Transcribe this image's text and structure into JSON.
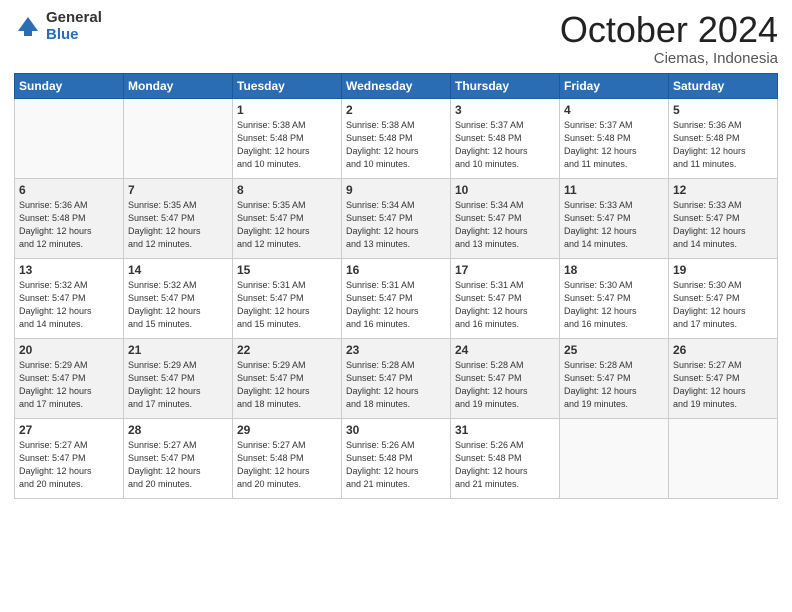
{
  "logo": {
    "general": "General",
    "blue": "Blue"
  },
  "header": {
    "title": "October 2024",
    "subtitle": "Ciemas, Indonesia"
  },
  "weekdays": [
    "Sunday",
    "Monday",
    "Tuesday",
    "Wednesday",
    "Thursday",
    "Friday",
    "Saturday"
  ],
  "weeks": [
    [
      {
        "day": "",
        "sunrise": "",
        "sunset": "",
        "daylight": ""
      },
      {
        "day": "",
        "sunrise": "",
        "sunset": "",
        "daylight": ""
      },
      {
        "day": "1",
        "sunrise": "Sunrise: 5:38 AM",
        "sunset": "Sunset: 5:48 PM",
        "daylight": "Daylight: 12 hours and 10 minutes."
      },
      {
        "day": "2",
        "sunrise": "Sunrise: 5:38 AM",
        "sunset": "Sunset: 5:48 PM",
        "daylight": "Daylight: 12 hours and 10 minutes."
      },
      {
        "day": "3",
        "sunrise": "Sunrise: 5:37 AM",
        "sunset": "Sunset: 5:48 PM",
        "daylight": "Daylight: 12 hours and 10 minutes."
      },
      {
        "day": "4",
        "sunrise": "Sunrise: 5:37 AM",
        "sunset": "Sunset: 5:48 PM",
        "daylight": "Daylight: 12 hours and 11 minutes."
      },
      {
        "day": "5",
        "sunrise": "Sunrise: 5:36 AM",
        "sunset": "Sunset: 5:48 PM",
        "daylight": "Daylight: 12 hours and 11 minutes."
      }
    ],
    [
      {
        "day": "6",
        "sunrise": "Sunrise: 5:36 AM",
        "sunset": "Sunset: 5:48 PM",
        "daylight": "Daylight: 12 hours and 12 minutes."
      },
      {
        "day": "7",
        "sunrise": "Sunrise: 5:35 AM",
        "sunset": "Sunset: 5:47 PM",
        "daylight": "Daylight: 12 hours and 12 minutes."
      },
      {
        "day": "8",
        "sunrise": "Sunrise: 5:35 AM",
        "sunset": "Sunset: 5:47 PM",
        "daylight": "Daylight: 12 hours and 12 minutes."
      },
      {
        "day": "9",
        "sunrise": "Sunrise: 5:34 AM",
        "sunset": "Sunset: 5:47 PM",
        "daylight": "Daylight: 12 hours and 13 minutes."
      },
      {
        "day": "10",
        "sunrise": "Sunrise: 5:34 AM",
        "sunset": "Sunset: 5:47 PM",
        "daylight": "Daylight: 12 hours and 13 minutes."
      },
      {
        "day": "11",
        "sunrise": "Sunrise: 5:33 AM",
        "sunset": "Sunset: 5:47 PM",
        "daylight": "Daylight: 12 hours and 14 minutes."
      },
      {
        "day": "12",
        "sunrise": "Sunrise: 5:33 AM",
        "sunset": "Sunset: 5:47 PM",
        "daylight": "Daylight: 12 hours and 14 minutes."
      }
    ],
    [
      {
        "day": "13",
        "sunrise": "Sunrise: 5:32 AM",
        "sunset": "Sunset: 5:47 PM",
        "daylight": "Daylight: 12 hours and 14 minutes."
      },
      {
        "day": "14",
        "sunrise": "Sunrise: 5:32 AM",
        "sunset": "Sunset: 5:47 PM",
        "daylight": "Daylight: 12 hours and 15 minutes."
      },
      {
        "day": "15",
        "sunrise": "Sunrise: 5:31 AM",
        "sunset": "Sunset: 5:47 PM",
        "daylight": "Daylight: 12 hours and 15 minutes."
      },
      {
        "day": "16",
        "sunrise": "Sunrise: 5:31 AM",
        "sunset": "Sunset: 5:47 PM",
        "daylight": "Daylight: 12 hours and 16 minutes."
      },
      {
        "day": "17",
        "sunrise": "Sunrise: 5:31 AM",
        "sunset": "Sunset: 5:47 PM",
        "daylight": "Daylight: 12 hours and 16 minutes."
      },
      {
        "day": "18",
        "sunrise": "Sunrise: 5:30 AM",
        "sunset": "Sunset: 5:47 PM",
        "daylight": "Daylight: 12 hours and 16 minutes."
      },
      {
        "day": "19",
        "sunrise": "Sunrise: 5:30 AM",
        "sunset": "Sunset: 5:47 PM",
        "daylight": "Daylight: 12 hours and 17 minutes."
      }
    ],
    [
      {
        "day": "20",
        "sunrise": "Sunrise: 5:29 AM",
        "sunset": "Sunset: 5:47 PM",
        "daylight": "Daylight: 12 hours and 17 minutes."
      },
      {
        "day": "21",
        "sunrise": "Sunrise: 5:29 AM",
        "sunset": "Sunset: 5:47 PM",
        "daylight": "Daylight: 12 hours and 17 minutes."
      },
      {
        "day": "22",
        "sunrise": "Sunrise: 5:29 AM",
        "sunset": "Sunset: 5:47 PM",
        "daylight": "Daylight: 12 hours and 18 minutes."
      },
      {
        "day": "23",
        "sunrise": "Sunrise: 5:28 AM",
        "sunset": "Sunset: 5:47 PM",
        "daylight": "Daylight: 12 hours and 18 minutes."
      },
      {
        "day": "24",
        "sunrise": "Sunrise: 5:28 AM",
        "sunset": "Sunset: 5:47 PM",
        "daylight": "Daylight: 12 hours and 19 minutes."
      },
      {
        "day": "25",
        "sunrise": "Sunrise: 5:28 AM",
        "sunset": "Sunset: 5:47 PM",
        "daylight": "Daylight: 12 hours and 19 minutes."
      },
      {
        "day": "26",
        "sunrise": "Sunrise: 5:27 AM",
        "sunset": "Sunset: 5:47 PM",
        "daylight": "Daylight: 12 hours and 19 minutes."
      }
    ],
    [
      {
        "day": "27",
        "sunrise": "Sunrise: 5:27 AM",
        "sunset": "Sunset: 5:47 PM",
        "daylight": "Daylight: 12 hours and 20 minutes."
      },
      {
        "day": "28",
        "sunrise": "Sunrise: 5:27 AM",
        "sunset": "Sunset: 5:47 PM",
        "daylight": "Daylight: 12 hours and 20 minutes."
      },
      {
        "day": "29",
        "sunrise": "Sunrise: 5:27 AM",
        "sunset": "Sunset: 5:48 PM",
        "daylight": "Daylight: 12 hours and 20 minutes."
      },
      {
        "day": "30",
        "sunrise": "Sunrise: 5:26 AM",
        "sunset": "Sunset: 5:48 PM",
        "daylight": "Daylight: 12 hours and 21 minutes."
      },
      {
        "day": "31",
        "sunrise": "Sunrise: 5:26 AM",
        "sunset": "Sunset: 5:48 PM",
        "daylight": "Daylight: 12 hours and 21 minutes."
      },
      {
        "day": "",
        "sunrise": "",
        "sunset": "",
        "daylight": ""
      },
      {
        "day": "",
        "sunrise": "",
        "sunset": "",
        "daylight": ""
      }
    ]
  ]
}
